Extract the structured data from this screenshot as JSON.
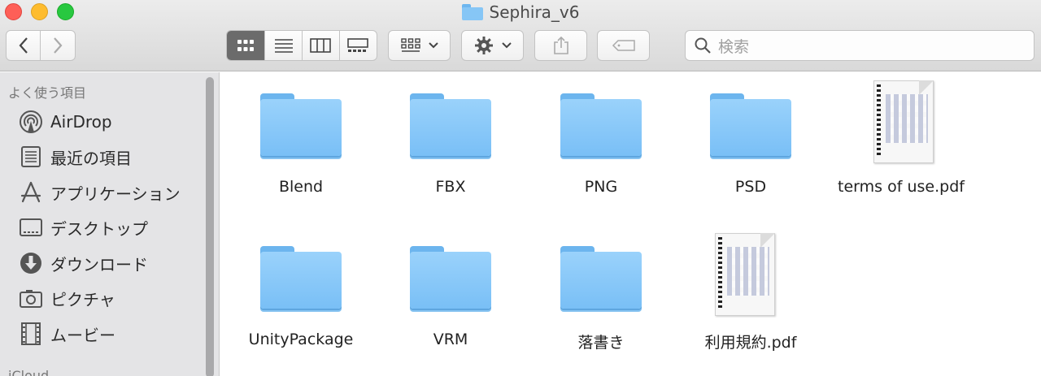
{
  "window": {
    "title": "Sephira_v6",
    "title_icon": "folder-icon"
  },
  "toolbar": {
    "back_icon": "chevron-left-icon",
    "forward_icon": "chevron-right-icon",
    "view_modes": [
      "icon-view-icon",
      "list-view-icon",
      "column-view-icon",
      "gallery-view-icon"
    ],
    "active_view": "icon-view-icon",
    "group_icon": "group-by-icon",
    "action_icon": "gear-icon",
    "share_icon": "share-icon",
    "tag_icon": "tag-icon",
    "search_placeholder": "検索"
  },
  "sidebar": {
    "section_favorites": "よく使う項目",
    "items": [
      {
        "label": "AirDrop",
        "icon": "airdrop-icon"
      },
      {
        "label": "最近の項目",
        "icon": "recents-icon"
      },
      {
        "label": "アプリケーション",
        "icon": "applications-icon"
      },
      {
        "label": "デスクトップ",
        "icon": "desktop-icon"
      },
      {
        "label": "ダウンロード",
        "icon": "downloads-icon"
      },
      {
        "label": "ピクチャ",
        "icon": "pictures-icon"
      },
      {
        "label": "ムービー",
        "icon": "movies-icon"
      }
    ],
    "section_next": "iCloud"
  },
  "files": [
    {
      "name": "Blend",
      "kind": "folder"
    },
    {
      "name": "FBX",
      "kind": "folder"
    },
    {
      "name": "PNG",
      "kind": "folder"
    },
    {
      "name": "PSD",
      "kind": "folder"
    },
    {
      "name": "terms of use.pdf",
      "kind": "pdf"
    },
    {
      "name": "UnityPackage",
      "kind": "folder"
    },
    {
      "name": "VRM",
      "kind": "folder"
    },
    {
      "name": "落書き",
      "kind": "folder"
    },
    {
      "name": "利用規約.pdf",
      "kind": "pdf"
    }
  ],
  "colors": {
    "folder_blue": "#86c6f6",
    "active_segment": "#6b6b6b"
  }
}
